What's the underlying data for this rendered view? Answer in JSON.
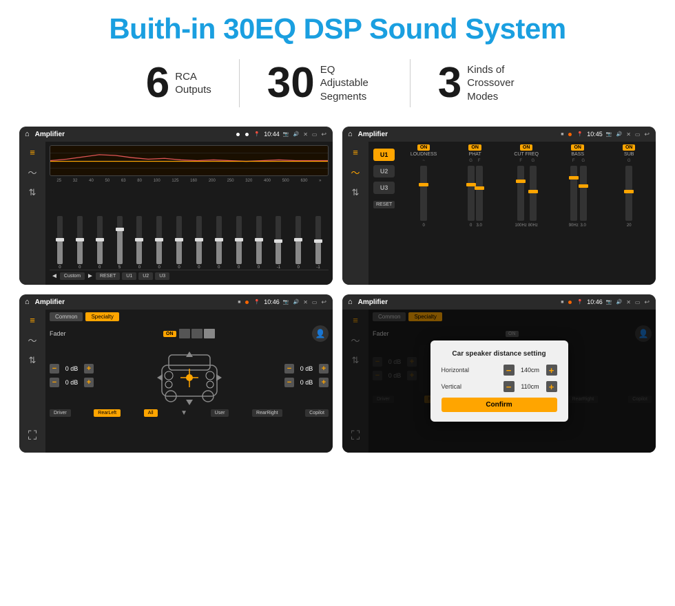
{
  "header": {
    "title": "Buith-in 30EQ DSP Sound System"
  },
  "stats": [
    {
      "number": "6",
      "label": "RCA\nOutputs"
    },
    {
      "number": "30",
      "label": "EQ Adjustable\nSegments"
    },
    {
      "number": "3",
      "label": "Kinds of\nCrossover Modes"
    }
  ],
  "screens": {
    "eq_screen": {
      "app_name": "Amplifier",
      "time": "10:44",
      "frequencies": [
        "25",
        "32",
        "40",
        "50",
        "63",
        "80",
        "100",
        "125",
        "160",
        "200",
        "250",
        "320",
        "400",
        "500",
        "630"
      ],
      "values": [
        "0",
        "0",
        "0",
        "5",
        "0",
        "0",
        "0",
        "0",
        "0",
        "0",
        "0",
        "-1",
        "0",
        "-1"
      ],
      "preset": "Custom",
      "buttons": [
        "RESET",
        "U1",
        "U2",
        "U3"
      ]
    },
    "crossover_screen": {
      "app_name": "Amplifier",
      "time": "10:45",
      "u_buttons": [
        "U1",
        "U2",
        "U3"
      ],
      "channels": [
        {
          "name": "LOUDNESS",
          "on": true
        },
        {
          "name": "PHAT",
          "on": true
        },
        {
          "name": "CUT FREQ",
          "on": true
        },
        {
          "name": "BASS",
          "on": true
        },
        {
          "name": "SUB",
          "on": true
        }
      ],
      "reset_label": "RESET"
    },
    "fader_screen": {
      "app_name": "Amplifier",
      "time": "10:46",
      "tabs": [
        "Common",
        "Specialty"
      ],
      "fader_label": "Fader",
      "fader_on": "ON",
      "db_controls": [
        {
          "value": "0 dB"
        },
        {
          "value": "0 dB"
        },
        {
          "value": "0 dB"
        },
        {
          "value": "0 dB"
        }
      ],
      "zone_buttons": [
        "Driver",
        "RearLeft",
        "All",
        "User",
        "RearRight",
        "Copilot"
      ]
    },
    "dialog_screen": {
      "app_name": "Amplifier",
      "time": "10:46",
      "tabs": [
        "Common",
        "Specialty"
      ],
      "dialog": {
        "title": "Car speaker distance setting",
        "horizontal_label": "Horizontal",
        "horizontal_value": "140cm",
        "vertical_label": "Vertical",
        "vertical_value": "110cm",
        "confirm_label": "Confirm"
      },
      "zone_buttons": [
        "Driver",
        "RearLeft",
        "All",
        "User",
        "RearRight",
        "Copilot"
      ]
    }
  }
}
